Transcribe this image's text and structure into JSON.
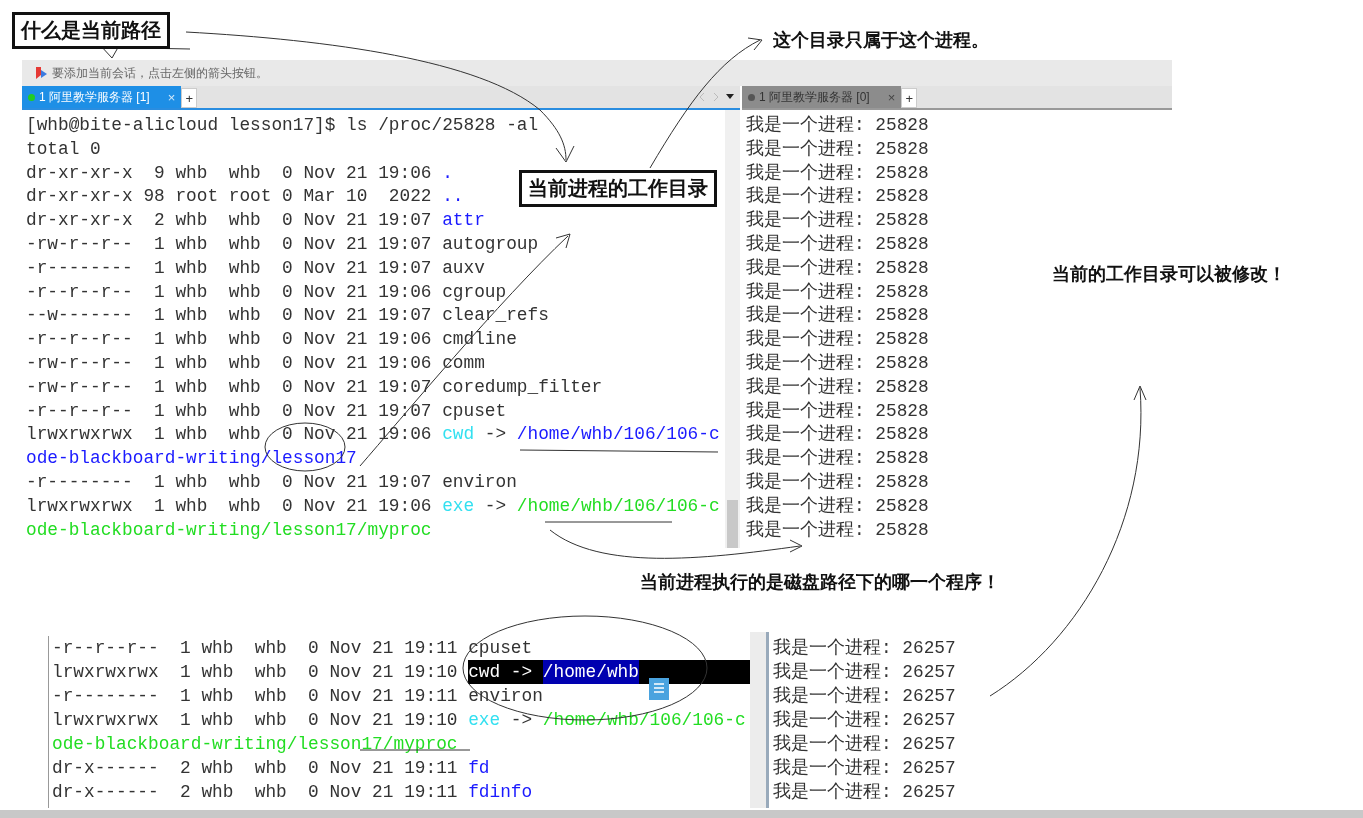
{
  "annotations": [
    {
      "kind": "boxed",
      "text": "什么是当前路径"
    },
    {
      "kind": "plain",
      "text": "这个目录只属于这个进程。"
    },
    {
      "kind": "boxed",
      "text": "当前进程的工作目录"
    },
    {
      "kind": "plain",
      "text": "当前的工作目录可以被修改！"
    },
    {
      "kind": "plain",
      "text": "当前进程执行的是磁盘路径下的哪一个程序！"
    }
  ],
  "top_window": {
    "hint": "要添加当前会话，点击左侧的箭头按钮。",
    "left_tab": {
      "label": "1 阿里教学服务器 [1]",
      "selected": true,
      "close": "×",
      "add": "+"
    },
    "right_tab": {
      "label": "1 阿里教学服务器 [0]",
      "selected": false,
      "close": "×",
      "add": "+"
    },
    "left_terminal": {
      "lines": [
        {
          "segments": [
            {
              "text": "[whb@bite-alicloud lesson17]$ ls /proc/25828 -al",
              "kind": "plain"
            }
          ]
        },
        {
          "segments": [
            {
              "text": "total 0",
              "kind": "plain"
            }
          ]
        },
        {
          "segments": [
            {
              "text": "dr-xr-xr-x  9 whb  whb  0 Nov 21 19:06 ",
              "kind": "plain"
            },
            {
              "text": ".",
              "kind": "dir"
            }
          ]
        },
        {
          "segments": [
            {
              "text": "dr-xr-xr-x 98 root root 0 Mar 10  2022 ",
              "kind": "plain"
            },
            {
              "text": "..",
              "kind": "dir"
            }
          ]
        },
        {
          "segments": [
            {
              "text": "dr-xr-xr-x  2 whb  whb  0 Nov 21 19:07 ",
              "kind": "plain"
            },
            {
              "text": "attr",
              "kind": "dir"
            }
          ]
        },
        {
          "segments": [
            {
              "text": "-rw-r--r--  1 whb  whb  0 Nov 21 19:07 autogroup",
              "kind": "plain"
            }
          ]
        },
        {
          "segments": [
            {
              "text": "-r--------  1 whb  whb  0 Nov 21 19:07 auxv",
              "kind": "plain"
            }
          ]
        },
        {
          "segments": [
            {
              "text": "-r--r--r--  1 whb  whb  0 Nov 21 19:06 cgroup",
              "kind": "plain"
            }
          ]
        },
        {
          "segments": [
            {
              "text": "--w-------  1 whb  whb  0 Nov 21 19:07 clear_refs",
              "kind": "plain"
            }
          ]
        },
        {
          "segments": [
            {
              "text": "-r--r--r--  1 whb  whb  0 Nov 21 19:06 cmdline",
              "kind": "plain"
            }
          ]
        },
        {
          "segments": [
            {
              "text": "-rw-r--r--  1 whb  whb  0 Nov 21 19:06 comm",
              "kind": "plain"
            }
          ]
        },
        {
          "segments": [
            {
              "text": "-rw-r--r--  1 whb  whb  0 Nov 21 19:07 coredump_filter",
              "kind": "plain"
            }
          ]
        },
        {
          "segments": [
            {
              "text": "-r--r--r--  1 whb  whb  0 Nov 21 19:07 cpuset",
              "kind": "plain"
            }
          ]
        },
        {
          "segments": [
            {
              "text": "lrwxrwxrwx  1 whb  whb  0 Nov 21 19:06 ",
              "kind": "plain"
            },
            {
              "text": "cwd",
              "kind": "link"
            },
            {
              "text": " -> ",
              "kind": "plain"
            },
            {
              "text": "/home/whb/106/106-c",
              "kind": "dir"
            }
          ]
        },
        {
          "segments": [
            {
              "text": "ode-blackboard-writing/lesson17",
              "kind": "dir"
            }
          ]
        },
        {
          "segments": [
            {
              "text": "-r--------  1 whb  whb  0 Nov 21 19:07 environ",
              "kind": "plain"
            }
          ]
        },
        {
          "segments": [
            {
              "text": "lrwxrwxrwx  1 whb  whb  0 Nov 21 19:06 ",
              "kind": "plain"
            },
            {
              "text": "exe",
              "kind": "link"
            },
            {
              "text": " -> ",
              "kind": "plain"
            },
            {
              "text": "/home/whb/106/106-c",
              "kind": "exec"
            }
          ]
        },
        {
          "segments": [
            {
              "text": "ode-blackboard-writing/lesson17/myproc",
              "kind": "exec"
            }
          ]
        }
      ]
    },
    "right_terminal": {
      "lines": [
        "我是一个进程: 25828",
        "我是一个进程: 25828",
        "我是一个进程: 25828",
        "我是一个进程: 25828",
        "我是一个进程: 25828",
        "我是一个进程: 25828",
        "我是一个进程: 25828",
        "我是一个进程: 25828",
        "我是一个进程: 25828",
        "我是一个进程: 25828",
        "我是一个进程: 25828",
        "我是一个进程: 25828",
        "我是一个进程: 25828",
        "我是一个进程: 25828",
        "我是一个进程: 25828",
        "我是一个进程: 25828",
        "我是一个进程: 25828",
        "我是一个进程: 25828"
      ]
    }
  },
  "bottom_window": {
    "left_terminal": {
      "lines": [
        {
          "highlighted": false,
          "segments": [
            {
              "text": "-r--r--r--  1 whb  whb  0 Nov 21 19:11 cpuset",
              "kind": "plain"
            }
          ]
        },
        {
          "highlighted": true,
          "segments": [
            {
              "text": "lrwxrwxrwx  1 whb  whb  0 Nov 21 19:10 ",
              "kind": "plain"
            },
            {
              "text": "cwd",
              "kind": "link"
            },
            {
              "text": " -> ",
              "kind": "plain"
            },
            {
              "text": "/home/whb",
              "kind": "dir"
            }
          ]
        },
        {
          "highlighted": false,
          "segments": [
            {
              "text": "-r--------  1 whb  whb  0 Nov 21 19:11 environ",
              "kind": "plain"
            }
          ]
        },
        {
          "highlighted": false,
          "segments": [
            {
              "text": "lrwxrwxrwx  1 whb  whb  0 Nov 21 19:10 ",
              "kind": "plain"
            },
            {
              "text": "exe",
              "kind": "link"
            },
            {
              "text": " -> ",
              "kind": "plain"
            },
            {
              "text": "/home/whb/106/106-c",
              "kind": "exec"
            }
          ]
        },
        {
          "highlighted": false,
          "segments": [
            {
              "text": "ode-blackboard-writing/lesson17/myproc",
              "kind": "exec"
            }
          ]
        },
        {
          "highlighted": false,
          "segments": [
            {
              "text": "dr-x------  2 whb  whb  0 Nov 21 19:11 ",
              "kind": "plain"
            },
            {
              "text": "fd",
              "kind": "dir"
            }
          ]
        },
        {
          "highlighted": false,
          "segments": [
            {
              "text": "dr-x------  2 whb  whb  0 Nov 21 19:11 ",
              "kind": "plain"
            },
            {
              "text": "fdinfo",
              "kind": "dir"
            }
          ]
        }
      ]
    },
    "right_terminal": {
      "lines": [
        "我是一个进程: 26257",
        "我是一个进程: 26257",
        "我是一个进程: 26257",
        "我是一个进程: 26257",
        "我是一个进程: 26257",
        "我是一个进程: 26257",
        "我是一个进程: 26257"
      ]
    }
  }
}
